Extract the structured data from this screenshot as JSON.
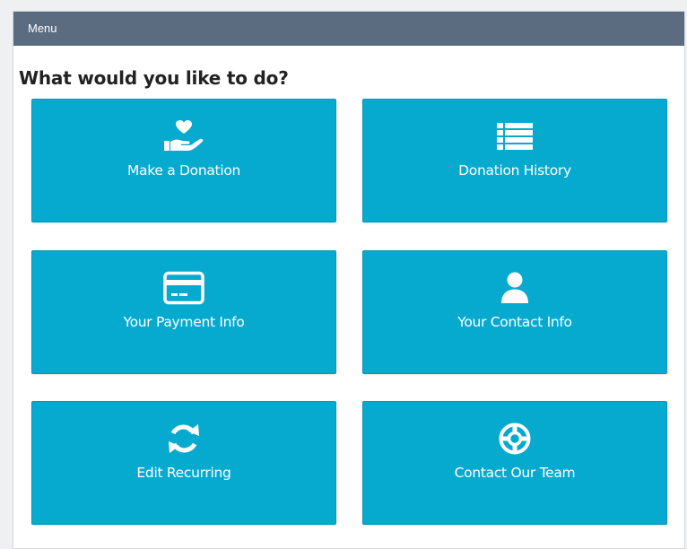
{
  "header": {
    "title": "Menu"
  },
  "main": {
    "heading": "What would you like to do?",
    "tiles": [
      {
        "label": "Make a Donation",
        "icon": "hand-heart-icon"
      },
      {
        "label": "Donation History",
        "icon": "list-icon"
      },
      {
        "label": "Your Payment Info",
        "icon": "credit-card-icon"
      },
      {
        "label": "Your Contact Info",
        "icon": "user-icon"
      },
      {
        "label": "Edit Recurring",
        "icon": "sync-icon"
      },
      {
        "label": "Contact Our Team",
        "icon": "lifesaver-icon"
      }
    ]
  },
  "colors": {
    "header_bg": "#5b6b80",
    "tile_bg": "#06aacf",
    "tile_text": "#ffffff",
    "heading_text": "#222222"
  }
}
